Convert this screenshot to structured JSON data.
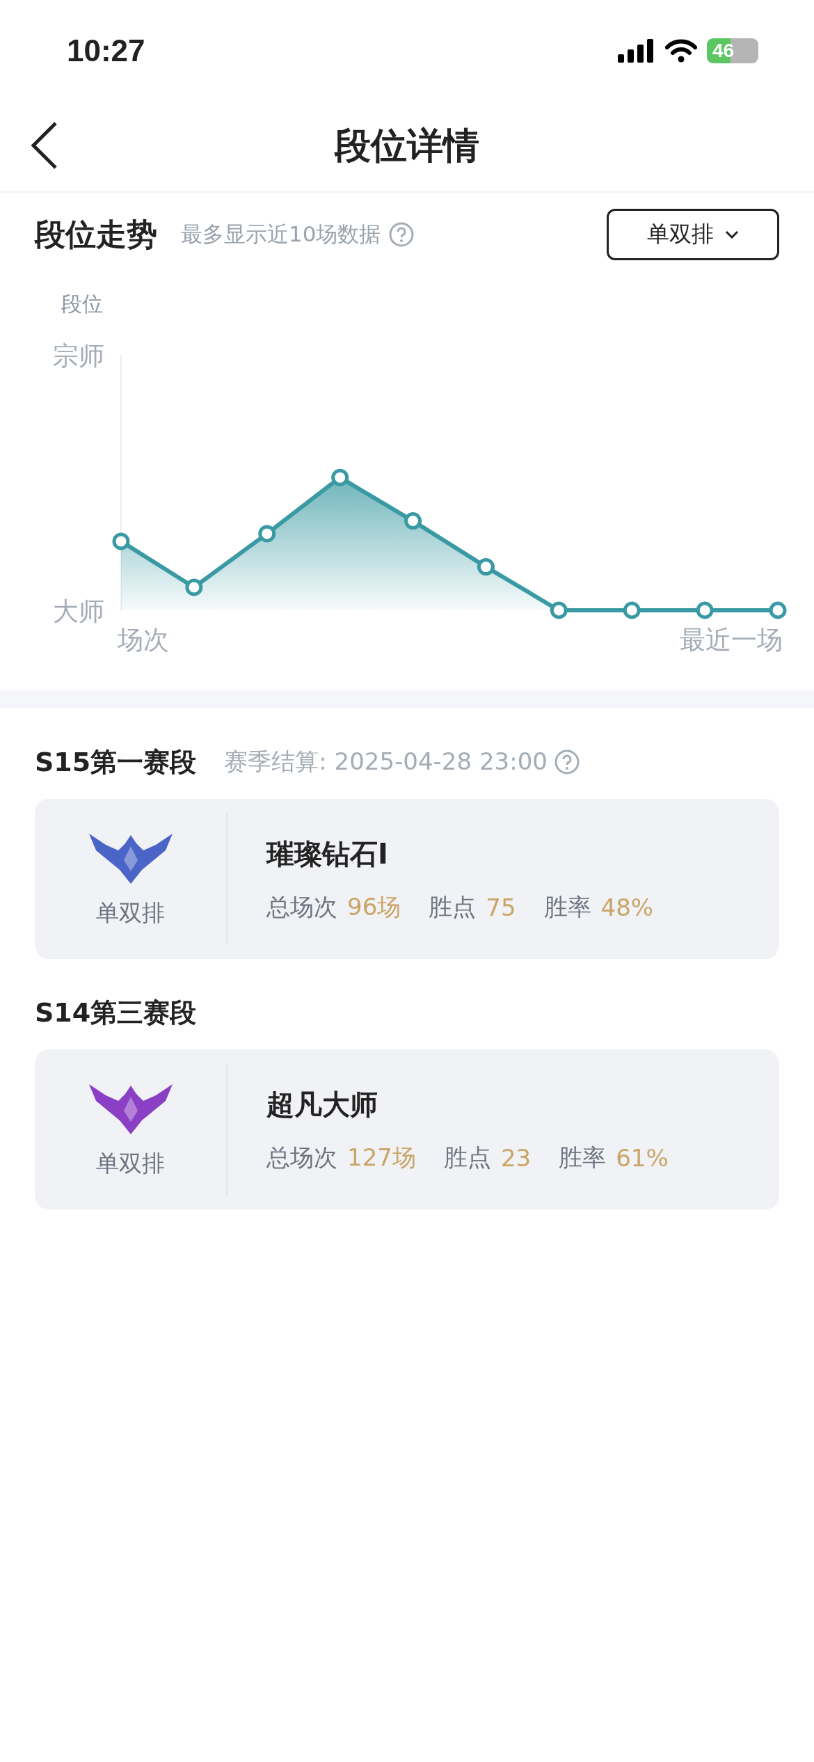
{
  "status_bar": {
    "time": "10:27",
    "battery": "46"
  },
  "header": {
    "title": "段位详情"
  },
  "trend": {
    "title": "段位走势",
    "note": "最多显示近10场数据",
    "dropdown": "单双排",
    "chart": {
      "y_title": "段位",
      "y_top": "宗师",
      "y_bottom": "大师",
      "x_start": "场次",
      "x_end": "最近一场"
    }
  },
  "seasons": [
    {
      "title": "S15第一赛段",
      "settle": "赛季结算: 2025-04-28 23:00",
      "color": "#4a64c8",
      "queue": "单双排",
      "rank": "璀璨钻石I",
      "stats": [
        {
          "label": "总场次",
          "value": "96场"
        },
        {
          "label": "胜点",
          "value": "75"
        },
        {
          "label": "胜率",
          "value": "48%"
        }
      ]
    },
    {
      "title": "S14第三赛段",
      "color": "#8a3fc4",
      "queue": "单双排",
      "rank": "超凡大师",
      "stats": [
        {
          "label": "总场次",
          "value": "127场"
        },
        {
          "label": "胜点",
          "value": "23"
        },
        {
          "label": "胜率",
          "value": "61%"
        }
      ]
    }
  ]
}
